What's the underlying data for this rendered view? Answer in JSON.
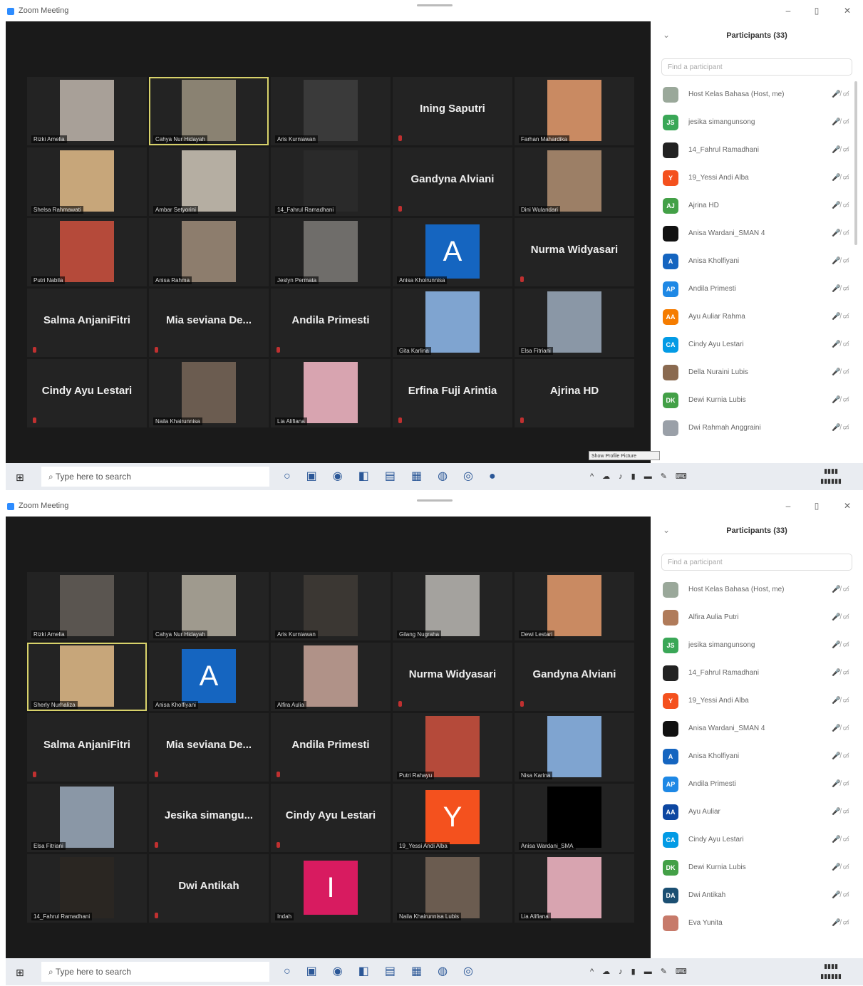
{
  "window": {
    "title": "Zoom Meeting"
  },
  "taskbar": {
    "search_placeholder": "Type here to search"
  },
  "screen1": {
    "participants_header": "Participants (33)",
    "participant_search": "Find a participant",
    "tooltip": "Show Profile Picture",
    "tiles": [
      {
        "type": "video",
        "caption": "Rizki Amelia",
        "color": "#a8a098",
        "active": false
      },
      {
        "type": "video",
        "caption": "Cahya Nur Hidayah",
        "color": "#8a8272",
        "active": true
      },
      {
        "type": "video",
        "caption": "Aris Kurniawan",
        "color": "#3a3a3a",
        "active": false
      },
      {
        "type": "name",
        "name": "Ining Saputri"
      },
      {
        "type": "video",
        "caption": "Farhan Mahardika",
        "color": "#c98a62",
        "active": false
      },
      {
        "type": "video",
        "caption": "Shelsa Rahmawati",
        "color": "#c7a67a",
        "active": false
      },
      {
        "type": "video",
        "caption": "Ambar Setyorini",
        "color": "#b5aea2",
        "active": false
      },
      {
        "type": "video",
        "caption": "14_Fahrul Ramadhani",
        "color": "#2a2a2a",
        "active": false
      },
      {
        "type": "name",
        "name": "Gandyna Alviani"
      },
      {
        "type": "video",
        "caption": "Dini Wulandari",
        "color": "#9c7f66",
        "active": false
      },
      {
        "type": "video",
        "caption": "Putri Nabila",
        "color": "#b54a3a",
        "active": false
      },
      {
        "type": "video",
        "caption": "Anisa Rahma",
        "color": "#8d7d6d",
        "active": false
      },
      {
        "type": "video",
        "caption": "Jeslyn Permata",
        "color": "#6f6d6a",
        "active": false
      },
      {
        "type": "avatar",
        "letter": "A",
        "bg": "#1565c0",
        "caption": "Anisa Khoirunnisa"
      },
      {
        "type": "name",
        "name": "Nurma Widyasari"
      },
      {
        "type": "name",
        "name": "Salma AnjaniFitri"
      },
      {
        "type": "name",
        "name": "Mia seviana De..."
      },
      {
        "type": "name",
        "name": "Andila Primesti"
      },
      {
        "type": "video",
        "caption": "Gita Karlina",
        "color": "#7fa4d0",
        "active": false
      },
      {
        "type": "video",
        "caption": "Elsa Fitriani",
        "color": "#8a97a6",
        "active": false
      },
      {
        "type": "name",
        "name": "Cindy Ayu Lestari"
      },
      {
        "type": "video",
        "caption": "Naila Khairunnisa",
        "color": "#6b5c50",
        "active": false
      },
      {
        "type": "video",
        "caption": "Lia Alifiana",
        "color": "#d8a4b0",
        "active": false
      },
      {
        "type": "name",
        "name": "Erfina Fuji Arintia"
      },
      {
        "type": "name",
        "name": "Ajrina HD"
      }
    ],
    "participants": [
      {
        "initials": "",
        "bg": "#9aa89a",
        "name": "Host Kelas Bahasa (Host, me)"
      },
      {
        "initials": "JS",
        "bg": "#3aa757",
        "name": "jesika simangunsong"
      },
      {
        "initials": "",
        "bg": "#222222",
        "name": "14_Fahrul Ramadhani"
      },
      {
        "initials": "Y",
        "bg": "#f4511e",
        "name": "19_Yessi Andi Alba"
      },
      {
        "initials": "AJ",
        "bg": "#43a047",
        "name": "Ajrina HD"
      },
      {
        "initials": "",
        "bg": "#111111",
        "name": "Anisa Wardani_SMAN 4"
      },
      {
        "initials": "A",
        "bg": "#1565c0",
        "name": "Anisa Kholfiyani"
      },
      {
        "initials": "AP",
        "bg": "#1e88e5",
        "name": "Andila Primesti"
      },
      {
        "initials": "AA",
        "bg": "#f57c00",
        "name": "Ayu Auliar Rahma"
      },
      {
        "initials": "CA",
        "bg": "#039be5",
        "name": "Cindy Ayu Lestari"
      },
      {
        "initials": "",
        "bg": "#8a6a50",
        "name": "Della Nuraini Lubis"
      },
      {
        "initials": "DK",
        "bg": "#43a047",
        "name": "Dewi Kurnia Lubis"
      },
      {
        "initials": "",
        "bg": "#9aa0a8",
        "name": "Dwi Rahmah Anggraini"
      }
    ]
  },
  "screen2": {
    "participants_header": "Participants (33)",
    "participant_search": "Find a participant",
    "tiles": [
      {
        "type": "video",
        "caption": "Rizki Amelia",
        "color": "#5a5550",
        "active": false
      },
      {
        "type": "video",
        "caption": "Cahya Nur Hidayah",
        "color": "#9f9a8e",
        "active": false
      },
      {
        "type": "video",
        "caption": "Aris Kurniawan",
        "color": "#3b3733",
        "active": false
      },
      {
        "type": "video",
        "caption": "Gilang Nugraha",
        "color": "#a4a29e",
        "active": false
      },
      {
        "type": "video",
        "caption": "Dewi Lestari",
        "color": "#c98a62",
        "active": false
      },
      {
        "type": "video",
        "caption": "Sherly Nurhaliza",
        "color": "#c7a67a",
        "active": true
      },
      {
        "type": "avatar",
        "letter": "A",
        "bg": "#1565c0",
        "caption": "Anisa Kholfiyani"
      },
      {
        "type": "video",
        "caption": "Alfira Aulia",
        "color": "#b09288",
        "active": false
      },
      {
        "type": "name",
        "name": "Nurma Widyasari"
      },
      {
        "type": "name",
        "name": "Gandyna Alviani"
      },
      {
        "type": "name",
        "name": "Salma AnjaniFitri"
      },
      {
        "type": "name",
        "name": "Mia seviana De..."
      },
      {
        "type": "name",
        "name": "Andila Primesti"
      },
      {
        "type": "video",
        "caption": "Putri Rahayu",
        "color": "#b54a3a",
        "active": false
      },
      {
        "type": "video",
        "caption": "Nisa Karina",
        "color": "#7fa4d0",
        "active": false
      },
      {
        "type": "video",
        "caption": "Elsa Fitriani",
        "color": "#8a97a6",
        "active": false
      },
      {
        "type": "name",
        "name": "Jesika simangu..."
      },
      {
        "type": "name",
        "name": "Cindy Ayu Lestari"
      },
      {
        "type": "avatar",
        "letter": "Y",
        "bg": "#f4511e",
        "caption": "19_Yessi Andi Alba"
      },
      {
        "type": "video",
        "caption": "Anisa Wardani_SMA",
        "color": "#000000",
        "active": false
      },
      {
        "type": "video",
        "caption": "14_Fahrul Ramadhani",
        "color": "#2a2622",
        "active": false
      },
      {
        "type": "name",
        "name": "Dwi Antikah"
      },
      {
        "type": "avatar",
        "letter": "I",
        "bg": "#d81b60",
        "caption": "Indah"
      },
      {
        "type": "video",
        "caption": "Naila Khairunnisa Lubis",
        "color": "#6b5c50",
        "active": false
      },
      {
        "type": "video",
        "caption": "Lia Alifiana",
        "color": "#d8a4b0",
        "active": false
      }
    ],
    "participants": [
      {
        "initials": "",
        "bg": "#9aa89a",
        "name": "Host Kelas Bahasa (Host, me)"
      },
      {
        "initials": "",
        "bg": "#b07b5a",
        "name": "Alfira Aulia Putri"
      },
      {
        "initials": "JS",
        "bg": "#3aa757",
        "name": "jesika simangunsong"
      },
      {
        "initials": "",
        "bg": "#222222",
        "name": "14_Fahrul Ramadhani"
      },
      {
        "initials": "Y",
        "bg": "#f4511e",
        "name": "19_Yessi Andi Alba"
      },
      {
        "initials": "",
        "bg": "#111111",
        "name": "Anisa Wardani_SMAN 4"
      },
      {
        "initials": "A",
        "bg": "#1565c0",
        "name": "Anisa Kholfiyani"
      },
      {
        "initials": "AP",
        "bg": "#1e88e5",
        "name": "Andila Primesti"
      },
      {
        "initials": "AA",
        "bg": "#0d47a1",
        "name": "Ayu Auliar"
      },
      {
        "initials": "CA",
        "bg": "#039be5",
        "name": "Cindy Ayu Lestari"
      },
      {
        "initials": "DK",
        "bg": "#43a047",
        "name": "Dewi Kurnia Lubis"
      },
      {
        "initials": "DA",
        "bg": "#1b4f72",
        "name": "Dwi Antikah"
      },
      {
        "initials": "",
        "bg": "#c77a6a",
        "name": "Eva Yunita"
      }
    ]
  }
}
